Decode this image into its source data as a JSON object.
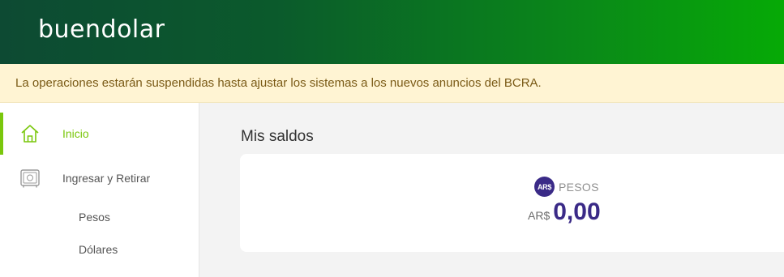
{
  "header": {
    "logo": "buendolar"
  },
  "notice": {
    "text": "La operaciones estarán suspendidas hasta ajustar los sistemas a los nuevos anuncios del BCRA."
  },
  "sidebar": {
    "items": [
      {
        "label": "Inicio",
        "icon": "home-icon",
        "active": true
      },
      {
        "label": "Ingresar y Retirar",
        "icon": "safe-icon",
        "active": false
      }
    ],
    "subitems": [
      {
        "label": "Pesos"
      },
      {
        "label": "Dólares"
      }
    ]
  },
  "main": {
    "title": "Mis saldos",
    "balance": {
      "badge": "AR$",
      "currency_name": "PESOS",
      "prefix": "AR$",
      "amount": "0,00"
    }
  },
  "colors": {
    "accent_green": "#7ac70c",
    "brand_purple": "#3a2a87",
    "notice_bg": "#fff4d3"
  }
}
